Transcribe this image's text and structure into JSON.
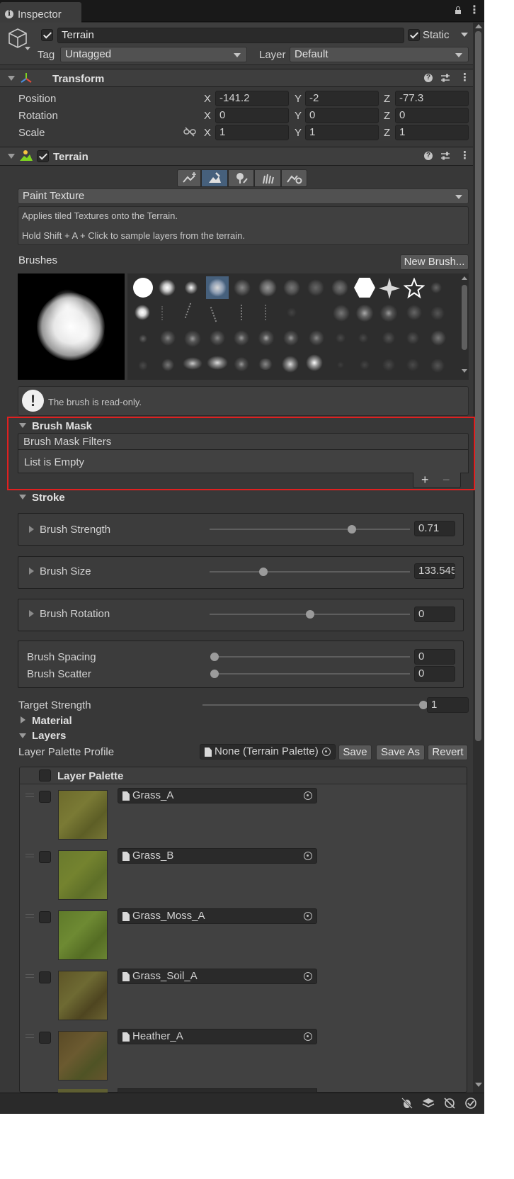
{
  "tab": {
    "title": "Inspector"
  },
  "object": {
    "name": "Terrain",
    "static_label": "Static",
    "tag_label": "Tag",
    "tag_value": "Untagged",
    "layer_label": "Layer",
    "layer_value": "Default"
  },
  "transform": {
    "title": "Transform",
    "position": {
      "label": "Position",
      "x": "-141.2",
      "y": "-2",
      "z": "-77.3"
    },
    "rotation": {
      "label": "Rotation",
      "x": "0",
      "y": "0",
      "z": "0"
    },
    "scale": {
      "label": "Scale",
      "x": "1",
      "y": "1",
      "z": "1"
    },
    "axis": {
      "x": "X",
      "y": "Y",
      "z": "Z"
    }
  },
  "terrain": {
    "title": "Terrain",
    "tool_dropdown": "Paint Texture",
    "help_line1": "Applies tiled Textures onto the Terrain.",
    "help_line2": "Hold Shift + A + Click to sample layers from the terrain.",
    "brushes_label": "Brushes",
    "new_brush_button": "New Brush...",
    "readonly_message": "The brush is read-only."
  },
  "brush_mask": {
    "title": "Brush Mask",
    "filters_header": "Brush Mask Filters",
    "empty_text": "List is Empty",
    "add": "+",
    "remove": "−"
  },
  "stroke": {
    "title": "Stroke",
    "strength": {
      "label": "Brush Strength",
      "value": "0.71",
      "fraction": 0.71
    },
    "size": {
      "label": "Brush Size",
      "value": "133.545",
      "fraction": 0.27
    },
    "rotation": {
      "label": "Brush Rotation",
      "value": "0",
      "fraction": 0.5
    },
    "spacing": {
      "label": "Brush Spacing",
      "value": "0",
      "fraction": 0
    },
    "scatter": {
      "label": "Brush Scatter",
      "value": "0",
      "fraction": 0
    }
  },
  "target_strength": {
    "label": "Target Strength",
    "value": "1",
    "fraction": 1
  },
  "material": {
    "title": "Material"
  },
  "layers": {
    "title": "Layers",
    "profile_label": "Layer Palette Profile",
    "profile_value": "None (Terrain Palette)",
    "save": "Save",
    "save_as": "Save As",
    "revert": "Revert",
    "palette_header": "Layer Palette",
    "items": [
      {
        "name": "Grass_A"
      },
      {
        "name": "Grass_B"
      },
      {
        "name": "Grass_Moss_A"
      },
      {
        "name": "Grass_Soil_A"
      },
      {
        "name": "Heather_A"
      }
    ]
  },
  "colors": {
    "accent_blue": "#46607c",
    "highlight_red": "#e02020"
  }
}
